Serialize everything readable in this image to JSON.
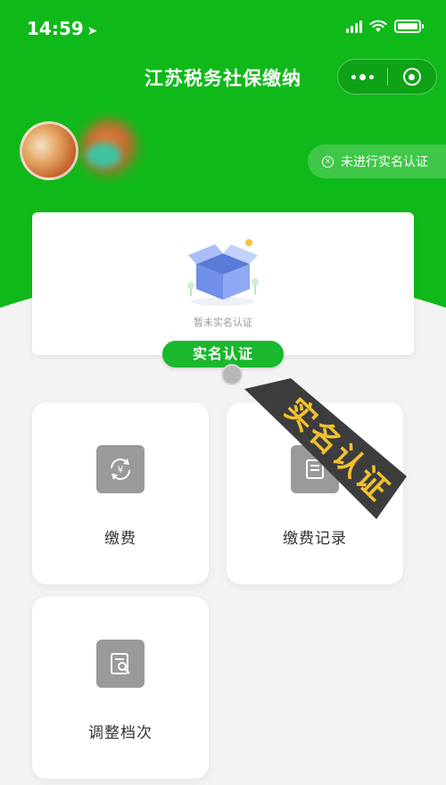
{
  "status_bar": {
    "time": "14:59"
  },
  "header": {
    "title": "江苏税务社保缴纳",
    "brand_color": "#10b91a"
  },
  "user": {
    "auth_status": "未进行实名认证"
  },
  "auth_card": {
    "empty_text": "暂未实名认证",
    "button_label": "实名认证"
  },
  "tiles": [
    {
      "label": "缴费",
      "icon": "yuan-refresh-icon"
    },
    {
      "label": "缴费记录",
      "icon": "record-icon"
    },
    {
      "label": "调整档次",
      "icon": "adjust-doc-icon"
    }
  ],
  "tag_overlay": {
    "text": "实名认证"
  }
}
